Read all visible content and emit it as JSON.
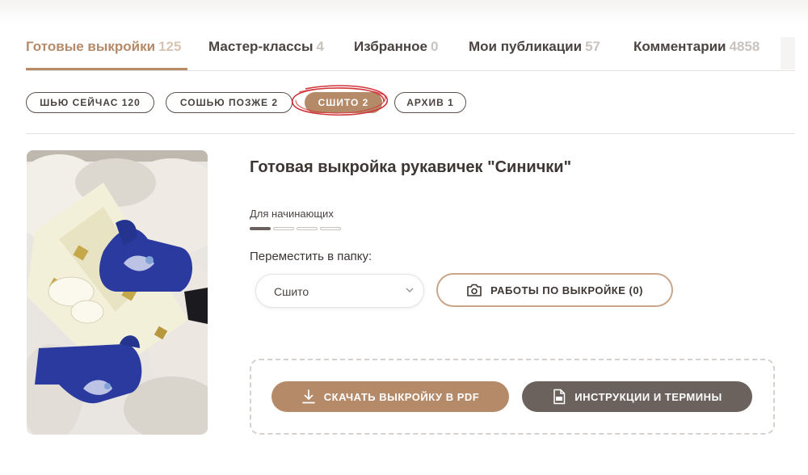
{
  "tabs": [
    {
      "label": "Готовые выкройки",
      "count": "125",
      "active": true
    },
    {
      "label": "Мастер-классы",
      "count": "4",
      "active": false
    },
    {
      "label": "Избранное",
      "count": "0",
      "active": false
    },
    {
      "label": "Мои публикации",
      "count": "57",
      "active": false
    },
    {
      "label": "Комментарии",
      "count": "4858",
      "active": false
    }
  ],
  "filters": [
    {
      "label": "ШЬЮ СЕЙЧАС 120",
      "active": false
    },
    {
      "label": "СОШЬЮ ПОЗЖЕ 2",
      "active": false
    },
    {
      "label": "СШИТО 2",
      "active": true
    },
    {
      "label": "АРХИВ 1",
      "active": false
    }
  ],
  "product": {
    "title": "Готовая выкройка рукавичек \"Синички\"",
    "level_label": "Для начинающих",
    "level": {
      "filled": 1,
      "total": 4
    },
    "move_label": "Переместить в папку:",
    "folder_value": "Сшито",
    "works_button": "РАБОТЫ ПО ВЫКРОЙКЕ (0)",
    "download_button": "СКАЧАТЬ ВЫКРОЙКУ В PDF",
    "instructions_button": "ИНСТРУКЦИИ И ТЕРМИНЫ"
  },
  "icons": {
    "works": "camera-icon",
    "download": "download-icon",
    "instructions": "pdf-file-icon",
    "select": "chevron-down-icon"
  },
  "colors": {
    "accent": "#b58a68",
    "dark_button": "#6b625e",
    "highlight_scribble": "#d0343a"
  }
}
